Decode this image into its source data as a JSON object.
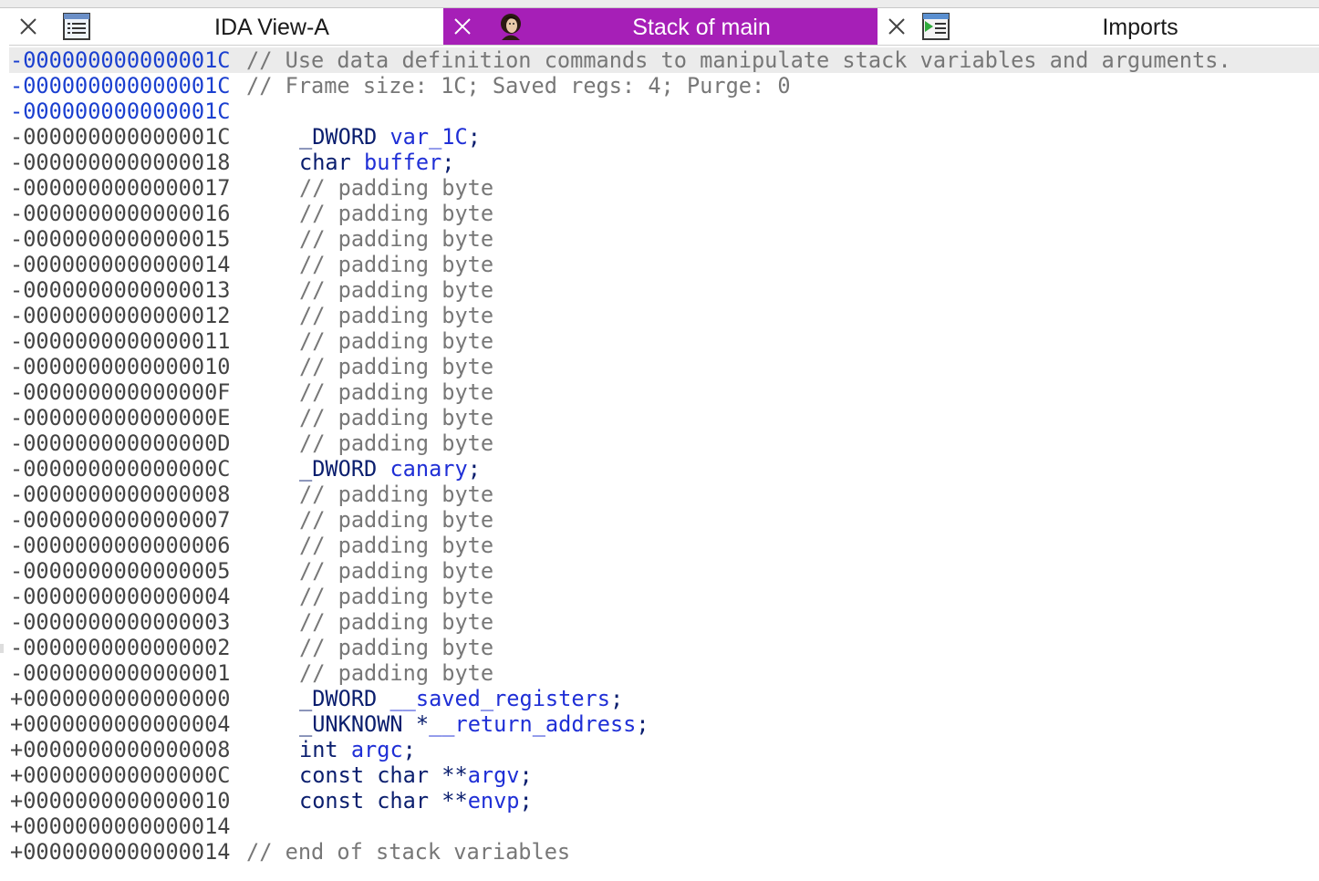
{
  "tabs": [
    {
      "label": "IDA View-A",
      "icon": "listing-icon",
      "active": false
    },
    {
      "label": "Stack of main",
      "icon": "portrait-icon",
      "active": true
    },
    {
      "label": "Imports",
      "icon": "imports-table-icon",
      "active": false
    }
  ],
  "colors": {
    "active_tab": "#a61fb7",
    "address_highlight": "#1a3fd0",
    "keyword": "#0a1e6e",
    "identifier": "#1f2fd6",
    "comment": "#777777"
  },
  "lines": [
    {
      "addr": "-000000000000001C",
      "comment": "// Use data definition commands to manipulate stack variables and arguments."
    },
    {
      "addr": "-000000000000001C",
      "comment": "// Frame size: 1C; Saved regs: 4; Purge: 0"
    },
    {
      "addr": "-000000000000001C"
    },
    {
      "addr": "-000000000000001C",
      "type": "_DWORD",
      "name": "var_1C",
      "end": ";"
    },
    {
      "addr": "-0000000000000018",
      "type": "char",
      "name": "buffer",
      "end": ";"
    },
    {
      "addr": "-0000000000000017",
      "comment": "// padding byte"
    },
    {
      "addr": "-0000000000000016",
      "comment": "// padding byte"
    },
    {
      "addr": "-0000000000000015",
      "comment": "// padding byte"
    },
    {
      "addr": "-0000000000000014",
      "comment": "// padding byte"
    },
    {
      "addr": "-0000000000000013",
      "comment": "// padding byte"
    },
    {
      "addr": "-0000000000000012",
      "comment": "// padding byte"
    },
    {
      "addr": "-0000000000000011",
      "comment": "// padding byte"
    },
    {
      "addr": "-0000000000000010",
      "comment": "// padding byte"
    },
    {
      "addr": "-000000000000000F",
      "comment": "// padding byte"
    },
    {
      "addr": "-000000000000000E",
      "comment": "// padding byte"
    },
    {
      "addr": "-000000000000000D",
      "comment": "// padding byte"
    },
    {
      "addr": "-000000000000000C",
      "type": "_DWORD",
      "name": "canary",
      "end": ";"
    },
    {
      "addr": "-0000000000000008",
      "comment": "// padding byte"
    },
    {
      "addr": "-0000000000000007",
      "comment": "// padding byte"
    },
    {
      "addr": "-0000000000000006",
      "comment": "// padding byte"
    },
    {
      "addr": "-0000000000000005",
      "comment": "// padding byte"
    },
    {
      "addr": "-0000000000000004",
      "comment": "// padding byte"
    },
    {
      "addr": "-0000000000000003",
      "comment": "// padding byte"
    },
    {
      "addr": "-0000000000000002",
      "comment": "// padding byte"
    },
    {
      "addr": "-0000000000000001",
      "comment": "// padding byte"
    },
    {
      "addr": "+0000000000000000",
      "type": "_DWORD",
      "name": "__saved_registers",
      "end": ";"
    },
    {
      "addr": "+0000000000000004",
      "type": "_UNKNOWN",
      "ptr": "*",
      "name": "__return_address",
      "end": ";"
    },
    {
      "addr": "+0000000000000008",
      "type": "int",
      "name": "argc",
      "end": ";"
    },
    {
      "addr": "+000000000000000C",
      "type": "const char",
      "ptr": "**",
      "name": "argv",
      "end": ";"
    },
    {
      "addr": "+0000000000000010",
      "type": "const char",
      "ptr": "**",
      "name": "envp",
      "end": ";"
    },
    {
      "addr": "+0000000000000014"
    },
    {
      "addr": "+0000000000000014",
      "comment": "// end of stack variables"
    }
  ]
}
